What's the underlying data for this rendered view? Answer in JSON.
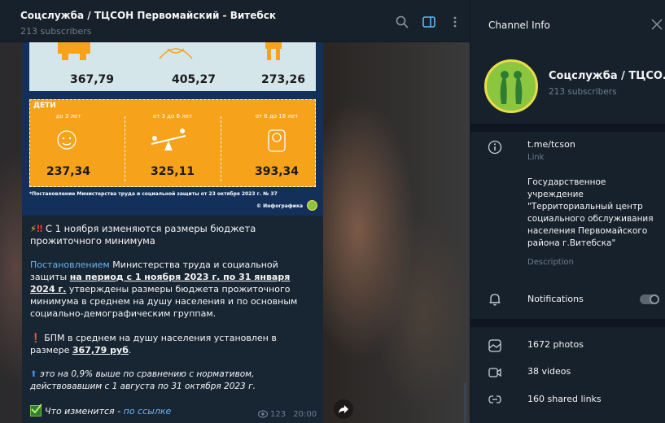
{
  "chat": {
    "title": "Соцслужба / ТЦСОН Первомайский - Витебск",
    "subscribers": "213 subscribers"
  },
  "infographic": {
    "top_values": [
      "367,79",
      "405,27",
      "273,26"
    ],
    "kids_title": "ДЕТИ",
    "kids": [
      {
        "age": "до 3 лет",
        "value": "237,34"
      },
      {
        "age": "от 3 до 6 лет",
        "value": "325,11"
      },
      {
        "age": "от 6 до 18 лет",
        "value": "393,34"
      }
    ],
    "footnote": "*Постановление Министерства труда и социальной защиты от 23 октября 2023 г. № 37",
    "credit": "© Инфографика"
  },
  "message": {
    "heading": "С 1 ноября изменяются размеры бюджета прожиточного минимума",
    "p1_link": "Постановлением",
    "p1_a": " Министерства труда и социальной защиты ",
    "p1_bold": "на период с 1 ноября 2023 г. по 31 января 2024 г.",
    "p1_b": " утверждены размеры бюджета прожиточного минимума в среднем на душу населения и по основным социально-демографическим группам.",
    "p2_a": " БПМ в среднем на душу населения установлен в размере ",
    "p2_bold": "367,79 руб",
    "p2_b": ".",
    "p3": " это на 0,9% выше по сравнению с нормативом, действовавшим с 1 августа по 31 октября 2023 г.",
    "p4_a": "Что изменится - ",
    "p4_link": "по ссылке",
    "views": "123",
    "time": "20:00"
  },
  "info_panel": {
    "header": "Channel Info",
    "channel_name": "Соцслужба / ТЦСО...",
    "subscribers": "213 subscribers",
    "link": "t.me/tcson",
    "link_label": "Link",
    "description": "Государственное учреждение \"Территориальный центр социального обслуживания населения Первомайского района г.Витебска\"",
    "description_label": "Description",
    "notifications": "Notifications",
    "notifications_on": false,
    "media": [
      {
        "icon": "photo-icon",
        "label": "1672 photos"
      },
      {
        "icon": "video-icon",
        "label": "38 videos"
      },
      {
        "icon": "link-icon",
        "label": "160 shared links"
      }
    ]
  },
  "colors": {
    "panel_bg": "#17212b",
    "chat_bg": "#0e1621",
    "bubble_bg": "#182533",
    "accent": "#6ab3f3",
    "muted": "#6d7f8f",
    "infographic_orange": "#f7a21b",
    "infographic_blue": "#12305a"
  }
}
